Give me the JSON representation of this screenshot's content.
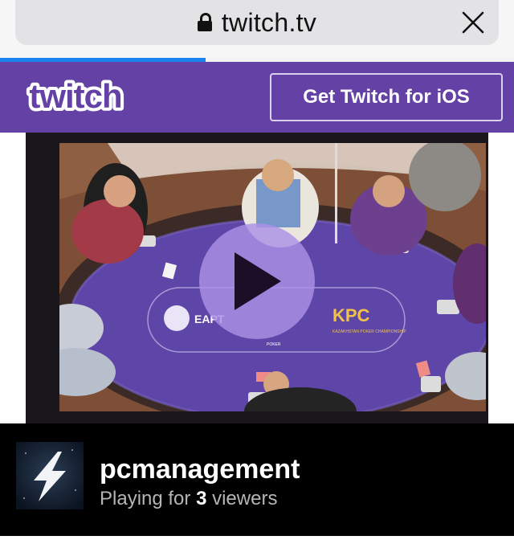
{
  "browser": {
    "url": "twitch.tv",
    "lock_icon": "lock-icon",
    "close_icon": "close-icon",
    "load_progress": 0.4
  },
  "header": {
    "logo_text": "twitch",
    "cta_label": "Get Twitch for iOS",
    "brand_color": "#6441a4"
  },
  "player": {
    "play_icon": "play-icon",
    "thumbnail_signage": {
      "table_logo": "EAPT",
      "sponsor_logo": "KPC",
      "sponsor_text": "KAZAKHSTAN POKER CHAMPIONSHIP",
      "small_logo": "POKER"
    }
  },
  "channel": {
    "name": "pcmanagement",
    "status_prefix": "Playing for",
    "viewer_count": "3",
    "status_suffix": "viewers",
    "avatar_icon": "lightning-bolt-icon"
  }
}
